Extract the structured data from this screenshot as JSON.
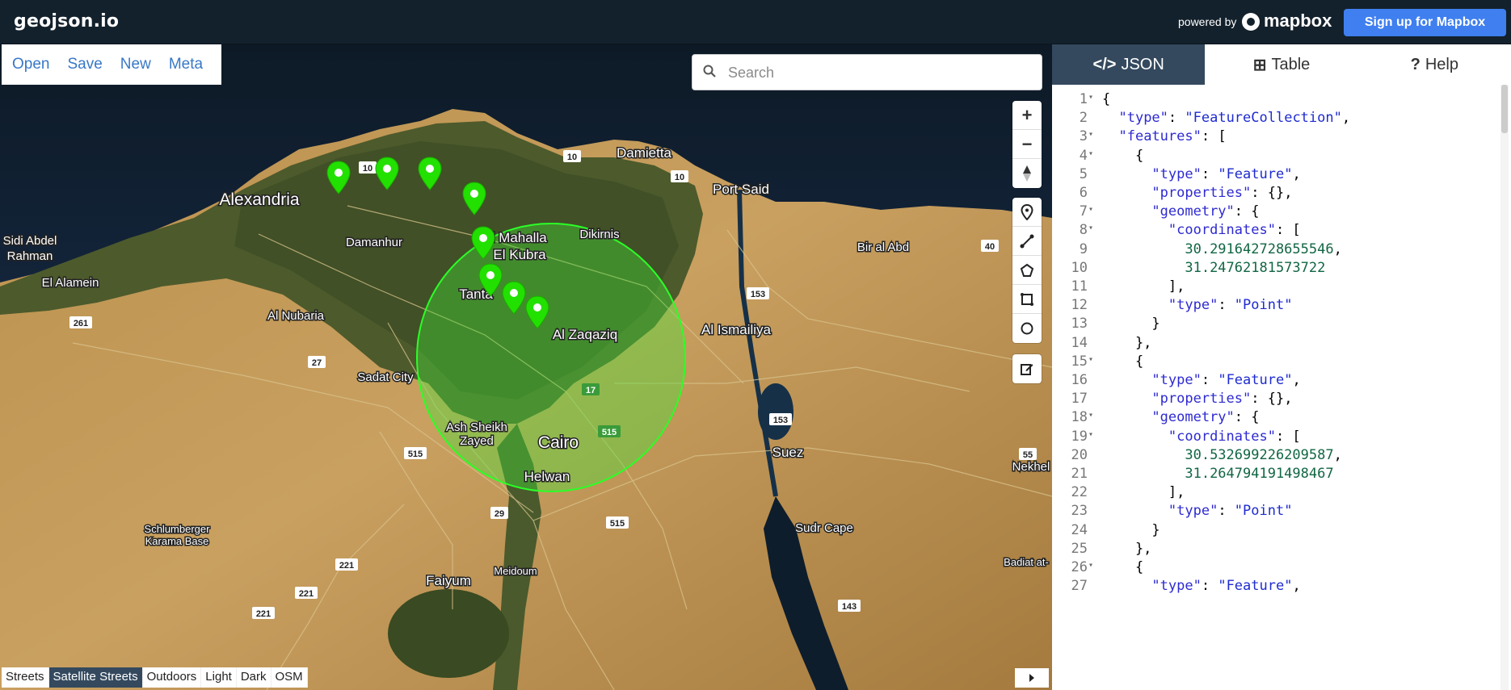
{
  "app": {
    "brand": "geojson.io",
    "powered_by": "powered by",
    "mapbox": "mapbox",
    "signup": "Sign up for Mapbox"
  },
  "file_menu": [
    "Open",
    "Save",
    "New",
    "Meta"
  ],
  "search": {
    "placeholder": "Search"
  },
  "map_controls": {
    "zoom_in": "+",
    "zoom_out": "−",
    "draw_tools": [
      "marker-icon",
      "line-icon",
      "polygon-icon",
      "rectangle-icon",
      "circle-icon"
    ],
    "edit": "edit-icon"
  },
  "map_labels": [
    "Alexandria",
    "Damietta",
    "Port Said",
    "Sidi Abdel",
    "Rahman",
    "El Alamein",
    "Damanhur",
    "El Mahalla",
    "El Kubra",
    "Dikirnis",
    "Bir al Abd",
    "Al Nubaria",
    "Tanta",
    "Al Zaqaziq",
    "Al Ismailiya",
    "Sadat City",
    "Ash Sheikh",
    "Zayed",
    "Cairo",
    "Helwan",
    "Suez",
    "Nekhel",
    "Schlumberger",
    "Karama Base",
    "Sudr Cape",
    "Faiyum",
    "Meidoum",
    "Badiat at-"
  ],
  "road_shields": [
    "10",
    "10",
    "10",
    "40",
    "261",
    "27",
    "153",
    "17",
    "515",
    "515",
    "153",
    "515",
    "55",
    "29",
    "221",
    "221",
    "221",
    "143"
  ],
  "map_styles": {
    "options": [
      "Streets",
      "Satellite Streets",
      "Outdoors",
      "Light",
      "Dark",
      "OSM"
    ],
    "selected": "Satellite Streets"
  },
  "markers_count": 8,
  "tabs": [
    {
      "label": "JSON",
      "icon": "code-icon",
      "glyph": "</>"
    },
    {
      "label": "Table",
      "icon": "table-icon",
      "glyph": "⊞"
    },
    {
      "label": "Help",
      "icon": "help-icon",
      "glyph": "?"
    }
  ],
  "active_tab": "JSON",
  "json_lines": [
    {
      "n": "1",
      "fold": true,
      "html": "{"
    },
    {
      "n": "2",
      "fold": false,
      "html": "  <span class='k'>\"type\"</span>: <span class='s'>\"FeatureCollection\"</span>,"
    },
    {
      "n": "3",
      "fold": true,
      "html": "  <span class='k'>\"features\"</span>: ["
    },
    {
      "n": "4",
      "fold": true,
      "html": "    {"
    },
    {
      "n": "5",
      "fold": false,
      "html": "      <span class='k'>\"type\"</span>: <span class='s'>\"Feature\"</span>,"
    },
    {
      "n": "6",
      "fold": false,
      "html": "      <span class='k'>\"properties\"</span>: {},"
    },
    {
      "n": "7",
      "fold": true,
      "html": "      <span class='k'>\"geometry\"</span>: {"
    },
    {
      "n": "8",
      "fold": true,
      "html": "        <span class='k'>\"coordinates\"</span>: ["
    },
    {
      "n": "9",
      "fold": false,
      "html": "          <span class='n'>30.291642728655546</span>,"
    },
    {
      "n": "10",
      "fold": false,
      "html": "          <span class='n'>31.24762181573722</span>"
    },
    {
      "n": "11",
      "fold": false,
      "html": "        ],"
    },
    {
      "n": "12",
      "fold": false,
      "html": "        <span class='k'>\"type\"</span>: <span class='s'>\"Point\"</span>"
    },
    {
      "n": "13",
      "fold": false,
      "html": "      }"
    },
    {
      "n": "14",
      "fold": false,
      "html": "    },"
    },
    {
      "n": "15",
      "fold": true,
      "html": "    {"
    },
    {
      "n": "16",
      "fold": false,
      "html": "      <span class='k'>\"type\"</span>: <span class='s'>\"Feature\"</span>,"
    },
    {
      "n": "17",
      "fold": false,
      "html": "      <span class='k'>\"properties\"</span>: {},"
    },
    {
      "n": "18",
      "fold": true,
      "html": "      <span class='k'>\"geometry\"</span>: {"
    },
    {
      "n": "19",
      "fold": true,
      "html": "        <span class='k'>\"coordinates\"</span>: ["
    },
    {
      "n": "20",
      "fold": false,
      "html": "          <span class='n'>30.532699226209587</span>,"
    },
    {
      "n": "21",
      "fold": false,
      "html": "          <span class='n'>31.264794191498467</span>"
    },
    {
      "n": "22",
      "fold": false,
      "html": "        ],"
    },
    {
      "n": "23",
      "fold": false,
      "html": "        <span class='k'>\"type\"</span>: <span class='s'>\"Point\"</span>"
    },
    {
      "n": "24",
      "fold": false,
      "html": "      }"
    },
    {
      "n": "25",
      "fold": false,
      "html": "    },"
    },
    {
      "n": "26",
      "fold": true,
      "html": "    {"
    },
    {
      "n": "27",
      "fold": false,
      "html": "      <span class='k'>\"type\"</span>: <span class='s'>\"Feature\"</span>,"
    }
  ]
}
